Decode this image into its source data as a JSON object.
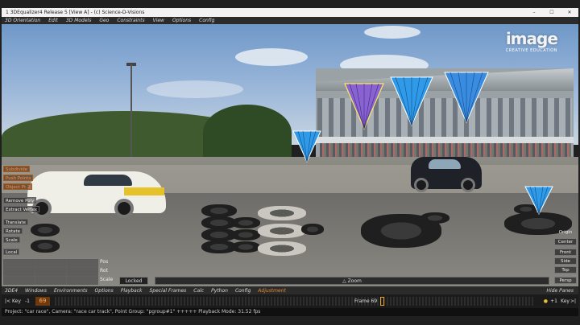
{
  "window": {
    "title": "1 3DEqualizer4 Release 5 [View A]   -   (c) Science-D-Visions",
    "controls": [
      "–",
      "☐",
      "✕"
    ]
  },
  "top_menu": [
    "3D Orientation",
    "Edit",
    "3D Models",
    "Geo",
    "Constraints",
    "View",
    "Options",
    "Config"
  ],
  "watermark": {
    "brand": "image",
    "tagline": "CREATIVE EDUCATION"
  },
  "left_panel": {
    "buttons": [
      "Subdivide",
      "Push Points",
      "Object Pt 2",
      "Remove Poly",
      "Extract Vertex",
      "Translate",
      "Rotate",
      "Scale",
      "Local"
    ],
    "grid_labels": [
      "Pos",
      "Rot",
      "Scale"
    ]
  },
  "right_panel": {
    "buttons": [
      "Origin",
      "Center",
      "Front",
      "Side",
      "Top",
      "Persp"
    ]
  },
  "viewport_controls": {
    "locked": "Locked",
    "zoom": "△ Zoom"
  },
  "bottom_menu": {
    "items": [
      "3DE4",
      "Windows",
      "Environments",
      "Options",
      "Playback",
      "Special Frames",
      "Calc",
      "Python",
      "Config",
      "Adjustment"
    ],
    "active": "Adjustment",
    "hide_panes": "Hide Panes"
  },
  "timeline": {
    "key_left": "Key",
    "step_left": "-1",
    "current_frame": "69",
    "frame_label": "Frame 69",
    "step_right": "+1",
    "key_right": "Key"
  },
  "status": "Project: \"car race\", Camera: \"race car track\", Point Group: \"pgroup#1\"  +++++ Playback Mode: 31.52 fps",
  "colors": {
    "accent": "#e8862e",
    "cone_blue": "#2f9be8",
    "cone_purple": "#8a63d2"
  }
}
